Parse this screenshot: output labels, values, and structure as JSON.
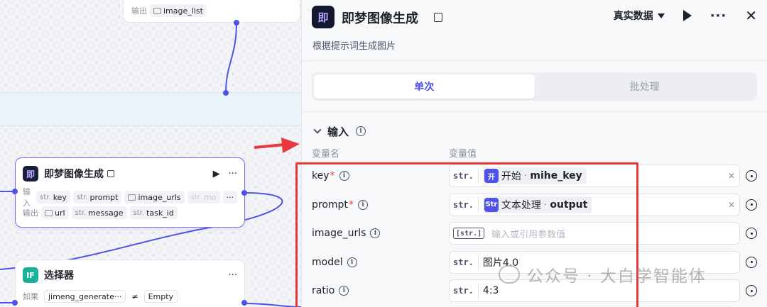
{
  "canvas": {
    "top_node": {
      "output_label": "输出",
      "output_var": "image_list"
    },
    "jimeng_node": {
      "title": "即梦图像生成",
      "logo_text": "即",
      "input_label": "输入",
      "output_label": "输出",
      "inputs": [
        {
          "type": "str.",
          "name": "key"
        },
        {
          "type": "str.",
          "name": "prompt"
        },
        {
          "type": "",
          "name": "image_urls"
        },
        {
          "type": "str.",
          "name": "mo"
        }
      ],
      "outputs": [
        {
          "type": "",
          "name": "url"
        },
        {
          "type": "str.",
          "name": "message"
        },
        {
          "type": "str.",
          "name": "task_id"
        }
      ],
      "more_inputs": "···"
    },
    "selector_node": {
      "badge": "IF",
      "title": "选择器",
      "cond_label": "如果",
      "cond_left": "jimeng_generate···",
      "cond_op": "≠",
      "cond_right": "Empty"
    }
  },
  "panel": {
    "title": "即梦图像生成",
    "logo_text": "即",
    "description": "根据提示词生成图片",
    "data_mode": "真实数据",
    "tabs": [
      "单次",
      "批处理"
    ],
    "active_tab": 0,
    "section_title": "输入",
    "col_name": "变量名",
    "col_value": "变量值",
    "params": [
      {
        "name": "key",
        "required": true,
        "type": "str.",
        "ref_icon": "开",
        "ref_source": "开始",
        "ref_var": "mihe_key"
      },
      {
        "name": "prompt",
        "required": true,
        "type": "str.",
        "ref_icon": "Str",
        "ref_source": "文本处理",
        "ref_var": "output"
      },
      {
        "name": "image_urls",
        "required": false,
        "type": "[str.]",
        "placeholder": "输入或引用参数值"
      },
      {
        "name": "model",
        "required": false,
        "type": "str.",
        "value": "图片4.0"
      },
      {
        "name": "ratio",
        "required": false,
        "type": "str.",
        "value": "4:3"
      }
    ]
  },
  "watermark": "公众号 · 大白学智能体",
  "colors": {
    "accent": "#4d53e8",
    "annotation_red": "#e8393f"
  }
}
